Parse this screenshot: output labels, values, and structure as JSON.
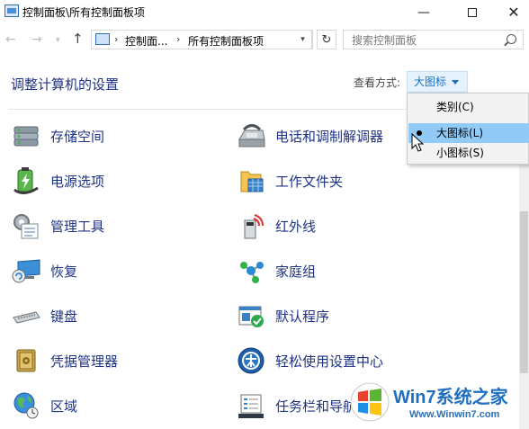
{
  "window": {
    "title": "控制面板\\所有控制面板项",
    "minimize_glyph": "—",
    "close_glyph": "✕"
  },
  "navigation": {
    "back_glyph": "←",
    "forward_glyph": "→",
    "up_glyph": "↑",
    "refresh_glyph": "↻",
    "breadcrumbs": [
      "控制面...",
      "所有控制面板项"
    ],
    "search_placeholder": "搜索控制面板"
  },
  "header": {
    "title": "调整计算机的设置",
    "view_by_label": "查看方式:",
    "view_by_value": "大图标"
  },
  "view_menu": {
    "options": [
      "类别(C)",
      "大图标(L)",
      "小图标(S)"
    ],
    "selected": "大图标(L)",
    "hovered": "大图标(L)"
  },
  "items": {
    "left": [
      {
        "label": "存储空间",
        "icon": "storage-spaces-icon"
      },
      {
        "label": "电源选项",
        "icon": "power-options-icon"
      },
      {
        "label": "管理工具",
        "icon": "admin-tools-icon"
      },
      {
        "label": "恢复",
        "icon": "recovery-icon"
      },
      {
        "label": "键盘",
        "icon": "keyboard-icon"
      },
      {
        "label": "凭据管理器",
        "icon": "credential-manager-icon"
      },
      {
        "label": "区域",
        "icon": "region-icon"
      }
    ],
    "right": [
      {
        "label": "电话和调制解调器",
        "icon": "phone-modem-icon"
      },
      {
        "label": "工作文件夹",
        "icon": "work-folders-icon"
      },
      {
        "label": "红外线",
        "icon": "infrared-icon"
      },
      {
        "label": "家庭组",
        "icon": "homegroup-icon"
      },
      {
        "label": "默认程序",
        "icon": "default-programs-icon"
      },
      {
        "label": "轻松使用设置中心",
        "icon": "ease-of-access-icon"
      },
      {
        "label": "任务栏和导航",
        "icon": "taskbar-navigation-icon"
      }
    ]
  },
  "watermark": {
    "title": "Win7系统之家",
    "url": "Www.Winwin7.com"
  },
  "colors": {
    "link": "#1e3287",
    "accent": "#1a6fc2",
    "menu_hover": "#91c9f7"
  }
}
